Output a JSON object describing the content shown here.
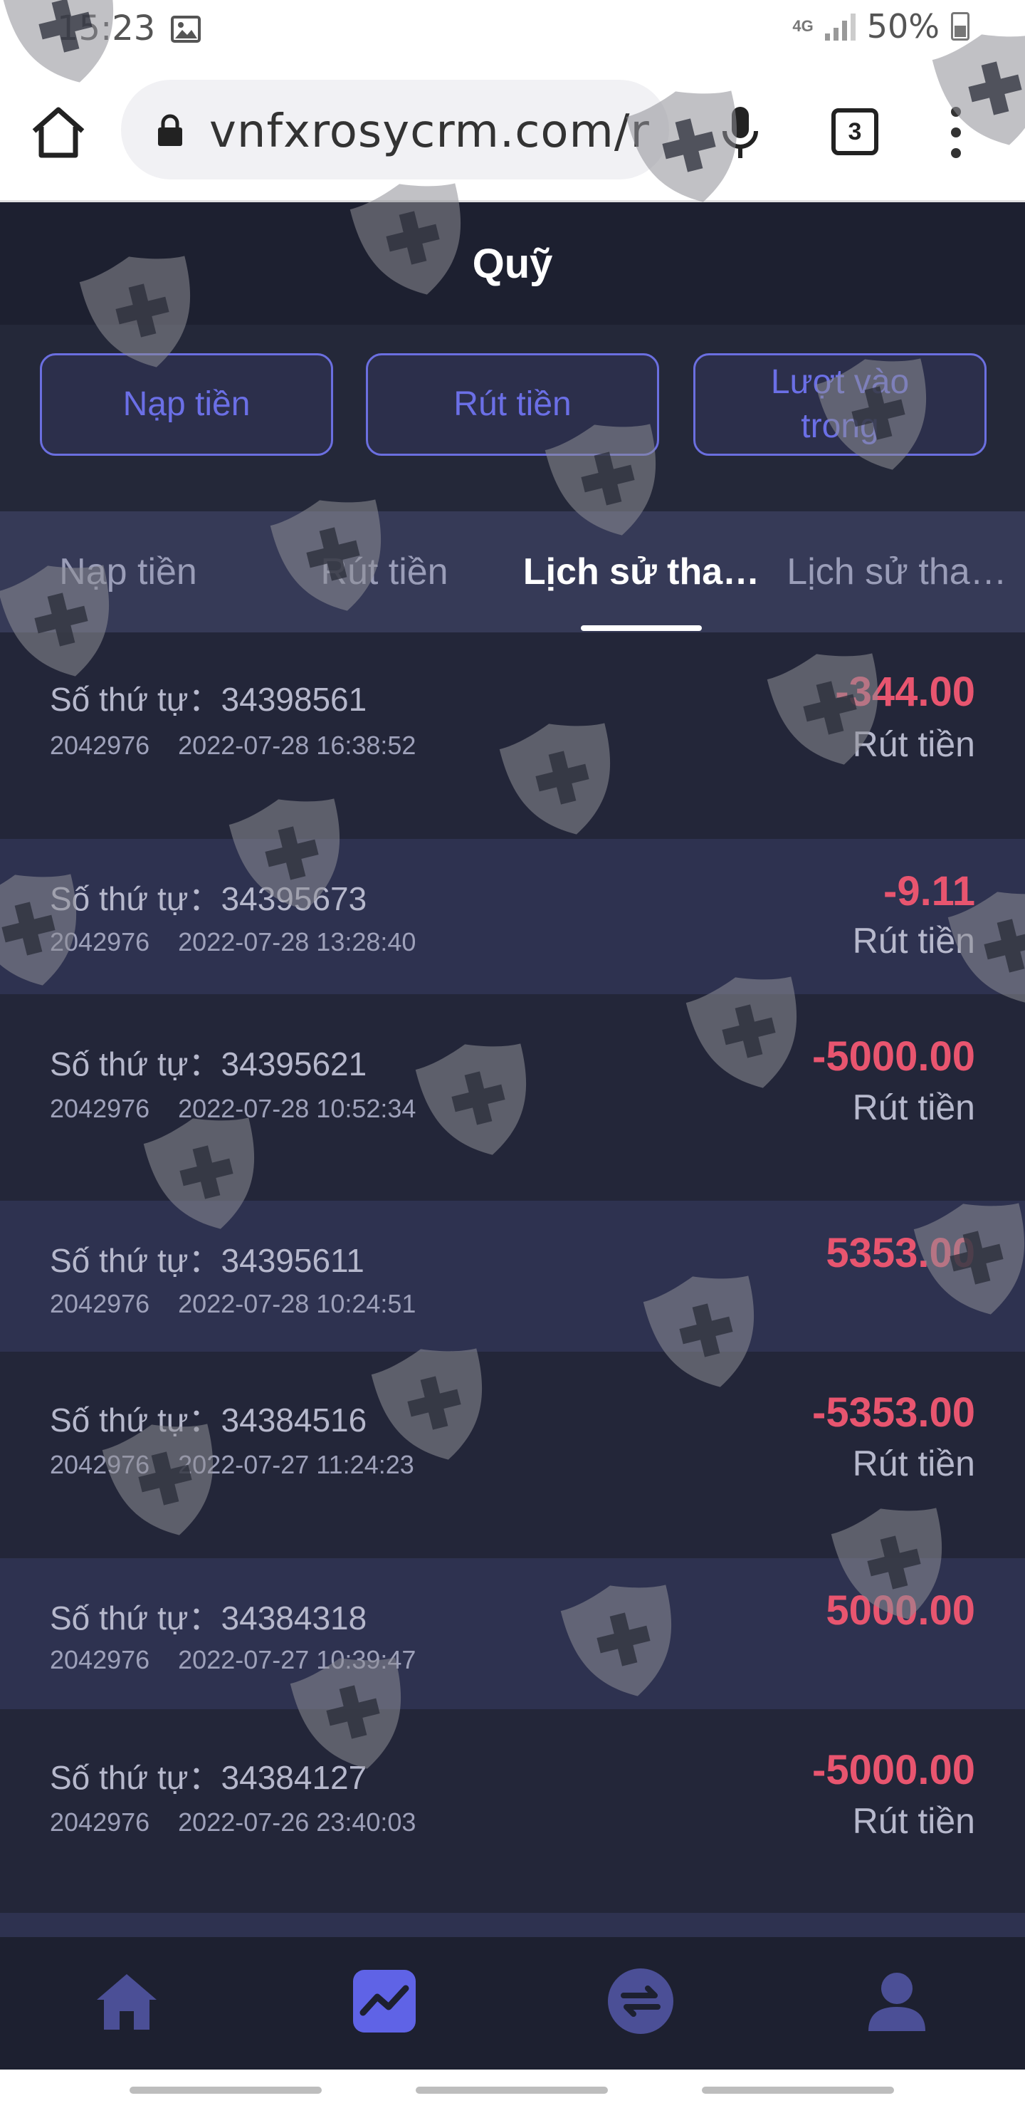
{
  "status_bar": {
    "time": "15:23",
    "network": "4G",
    "battery": "50%"
  },
  "browser": {
    "url": "vnfxrosycrm.com/r",
    "tab_count": "3"
  },
  "app": {
    "title": "Quỹ",
    "action_buttons": [
      {
        "label": "Nạp tiền"
      },
      {
        "label": "Rút tiền"
      },
      {
        "label": "Lượt vào trong"
      }
    ],
    "tabs": [
      {
        "label": "Nạp tiền",
        "active": false
      },
      {
        "label": "Rút tiền",
        "active": false
      },
      {
        "label": "Lịch sử tha…",
        "active": true
      },
      {
        "label": "Lịch sử tha…",
        "active": false
      }
    ],
    "records": [
      {
        "order": "Số thứ tự：34398561",
        "account": "2042976",
        "date": "2022-07-28 16:38:52",
        "amount": "-344.00",
        "type": "Rút tiền"
      },
      {
        "order": "Số thứ tự：34395673",
        "account": "2042976",
        "date": "2022-07-28 13:28:40",
        "amount": "-9.11",
        "type": "Rút tiền"
      },
      {
        "order": "Số thứ tự：34395621",
        "account": "2042976",
        "date": "2022-07-28 10:52:34",
        "amount": "-5000.00",
        "type": "Rút tiền"
      },
      {
        "order": "Số thứ tự：34395611",
        "account": "2042976",
        "date": "2022-07-28 10:24:51",
        "amount": "5353.00",
        "type": ""
      },
      {
        "order": "Số thứ tự：34384516",
        "account": "2042976",
        "date": "2022-07-27 11:24:23",
        "amount": "-5353.00",
        "type": "Rút tiền"
      },
      {
        "order": "Số thứ tự：34384318",
        "account": "2042976",
        "date": "2022-07-27 10:39:47",
        "amount": "5000.00",
        "type": ""
      },
      {
        "order": "Số thứ tự：34384127",
        "account": "2042976",
        "date": "2022-07-26 23:40:03",
        "amount": "-5000.00",
        "type": "Rút tiền"
      }
    ],
    "bottom_nav": [
      {
        "icon": "home-icon",
        "active": false
      },
      {
        "icon": "chart-icon",
        "active": true
      },
      {
        "icon": "exchange-icon",
        "active": false
      },
      {
        "icon": "user-icon",
        "active": false
      }
    ]
  },
  "colors": {
    "accent": "#5f63e6",
    "negative": "#e8556f",
    "background": "#232639",
    "row_alt": "#2e3250"
  }
}
